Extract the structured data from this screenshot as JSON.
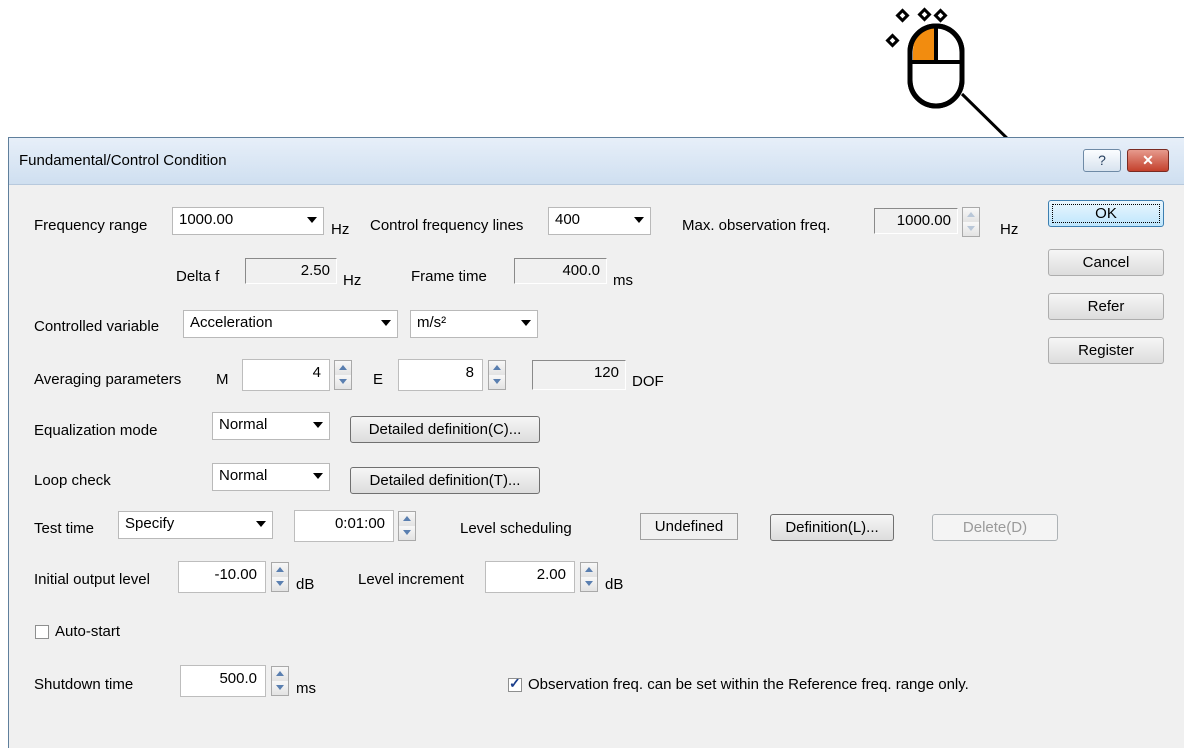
{
  "dialog": {
    "title": "Fundamental/Control Condition",
    "help_glyph": "?",
    "close_glyph": "✕"
  },
  "buttons": {
    "ok": "OK",
    "cancel": "Cancel",
    "refer": "Refer",
    "register": "Register"
  },
  "frequency": {
    "label": "Frequency range",
    "value": "1000.00",
    "unit": "Hz",
    "control_lines_label": "Control frequency lines",
    "control_lines_value": "400",
    "max_obs_label": "Max. observation freq.",
    "max_obs_value": "1000.00",
    "max_obs_unit": "Hz",
    "delta_f_label": "Delta f",
    "delta_f_value": "2.50",
    "delta_f_unit": "Hz",
    "frame_time_label": "Frame time",
    "frame_time_value": "400.0",
    "frame_time_unit": "ms"
  },
  "controlled": {
    "label": "Controlled variable",
    "variable": "Acceleration",
    "unit": "m/s²"
  },
  "averaging": {
    "label": "Averaging parameters",
    "m_label": "M",
    "m_value": "4",
    "e_label": "E",
    "e_value": "8",
    "dof_value": "120",
    "dof_label": "DOF"
  },
  "equalization": {
    "label": "Equalization mode",
    "value": "Normal",
    "button": "Detailed definition(C)..."
  },
  "loop_check": {
    "label": "Loop check",
    "value": "Normal",
    "button": "Detailed definition(T)..."
  },
  "test_time": {
    "label": "Test time",
    "mode": "Specify",
    "value": "0:01:00",
    "scheduling_label": "Level scheduling",
    "scheduling_status": "Undefined",
    "definition_button": "Definition(L)...",
    "delete_button": "Delete(D)"
  },
  "output": {
    "initial_label": "Initial output level",
    "initial_value": "-10.00",
    "initial_unit": "dB",
    "increment_label": "Level increment",
    "increment_value": "2.00",
    "increment_unit": "dB"
  },
  "auto_start": {
    "label": "Auto-start",
    "checked": false
  },
  "shutdown": {
    "label": "Shutdown time",
    "value": "500.0",
    "unit": "ms"
  },
  "observation_only": {
    "label": "Observation freq. can be set within the Reference freq. range only.",
    "checked": true
  },
  "colors": {
    "cursor_highlight": "#f28c0f",
    "dialog_bg": "#f0f0f0",
    "title_bar": "#dce7f4"
  },
  "annotation": {
    "icon": "mouse-icon"
  }
}
